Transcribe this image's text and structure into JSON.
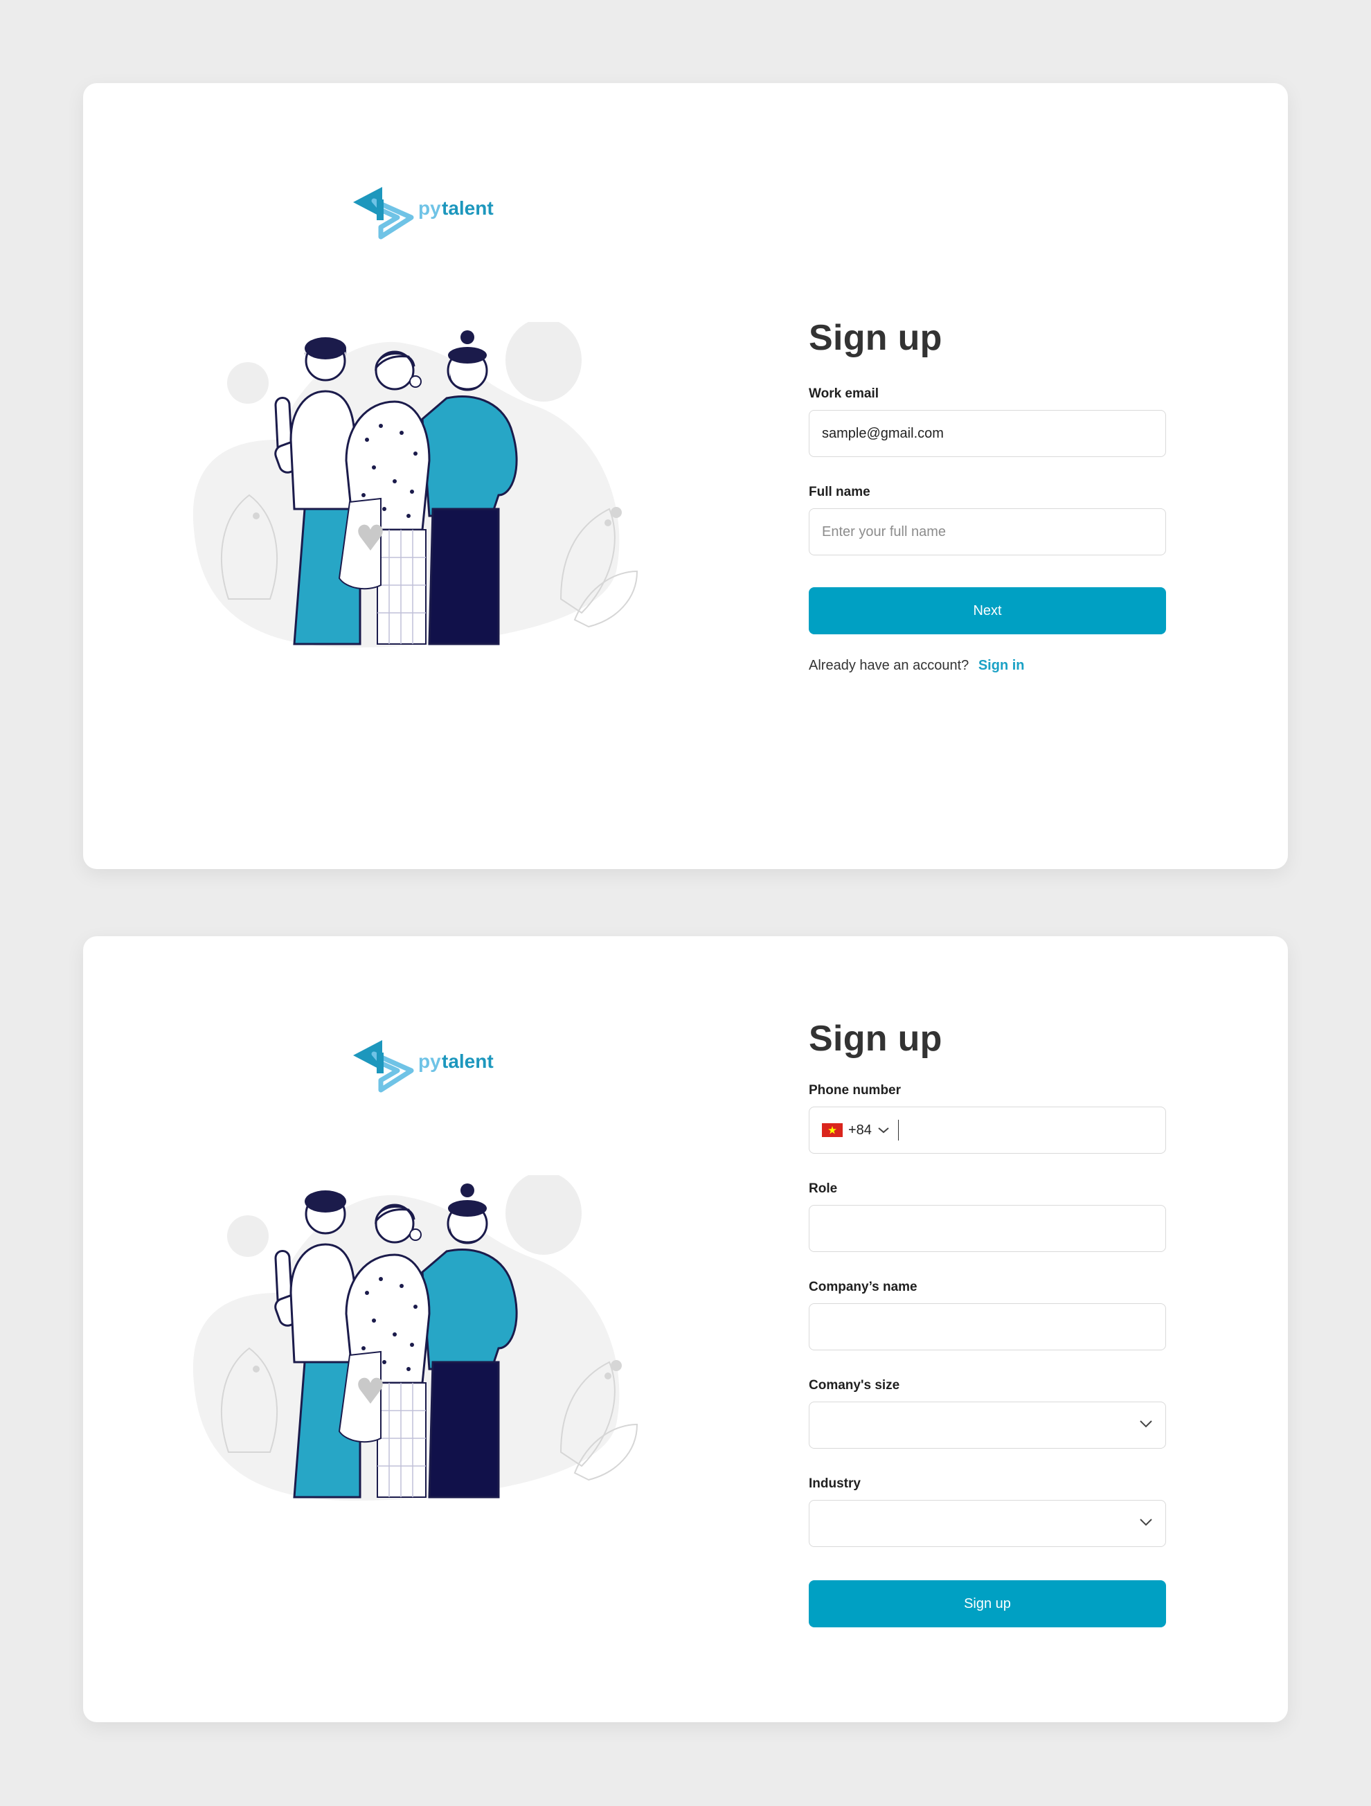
{
  "brand": {
    "name": "pytalent",
    "name_prefix": "py",
    "name_suffix": "talent",
    "color_light": "#6fc3e6",
    "color_dark": "#1d97bd"
  },
  "colors": {
    "primary": "#00a0c3",
    "background": "#ececec",
    "card": "#ffffff"
  },
  "step1": {
    "title": "Sign up",
    "email_label": "Work email",
    "email_value": "sample@gmail.com",
    "fullname_label": "Full name",
    "fullname_placeholder": "Enter your full name",
    "next_button": "Next",
    "footer_text": "Already have an account?",
    "signin_link": "Sign in"
  },
  "step2": {
    "title": "Sign up",
    "phone_label": "Phone number",
    "country_code": "+84",
    "country_flag": "vietnam-flag-icon",
    "role_label": "Role",
    "role_value": "",
    "company_label": "Company’s name",
    "company_value": "",
    "size_label": "Comany's size",
    "size_value": "",
    "industry_label": "Industry",
    "industry_value": "",
    "signup_button": "Sign up"
  }
}
